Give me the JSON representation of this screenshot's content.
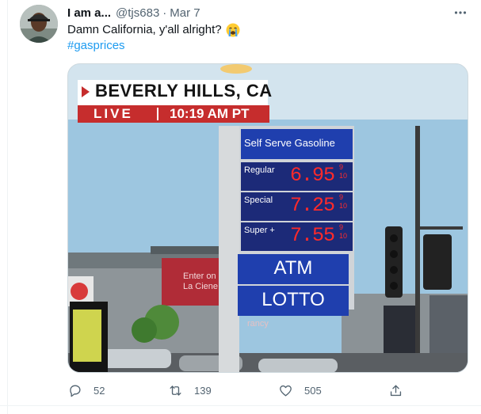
{
  "tweet": {
    "display_name": "I am a...",
    "handle": "@tjs683",
    "separator": "·",
    "date": "Mar 7",
    "text": "Damn California, y'all alright?",
    "emoji": "crying-face-emoji",
    "hashtag": "#gasprices"
  },
  "media": {
    "location_banner": "BEVERLY HILLS, CA",
    "live_label": "LIVE",
    "time_label": "10:19 AM PT",
    "sign_header": "Self Serve Gasoline",
    "prices": [
      {
        "grade": "Regular",
        "price": "6.95",
        "tenths_top": "9",
        "tenths_bottom": "10"
      },
      {
        "grade": "Special",
        "price": "7.25",
        "tenths_top": "9",
        "tenths_bottom": "10"
      },
      {
        "grade": "Super +",
        "price": "7.55",
        "tenths_top": "9",
        "tenths_bottom": "10"
      }
    ],
    "atm_label": "ATM",
    "lotto_label": "LOTTO",
    "storefront_line1": "Enter on",
    "storefront_line2": "La Ciene",
    "storefront_partial": "rancy"
  },
  "actions": {
    "reply_count": "52",
    "retweet_count": "139",
    "like_count": "505"
  },
  "colors": {
    "accent": "#1d9bf0",
    "secondary_text": "#536471",
    "sign_blue": "#1f3fae",
    "price_red": "#ff2a2a"
  },
  "icons": [
    "more-icon",
    "reply-icon",
    "retweet-icon",
    "like-icon",
    "share-icon"
  ]
}
